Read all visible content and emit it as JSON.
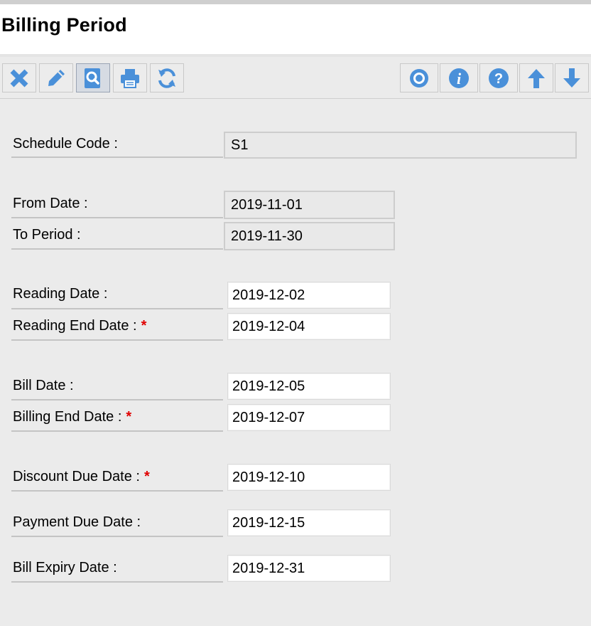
{
  "page": {
    "title": "Billing Period"
  },
  "toolbar": {
    "left_buttons": [
      {
        "name": "delete",
        "icon": "x-icon"
      },
      {
        "name": "edit",
        "icon": "pencil-icon"
      },
      {
        "name": "search",
        "icon": "magnifier-icon"
      },
      {
        "name": "print",
        "icon": "printer-icon"
      },
      {
        "name": "refresh",
        "icon": "refresh-icon"
      }
    ],
    "right_buttons": [
      {
        "name": "settings",
        "icon": "gear-icon"
      },
      {
        "name": "info",
        "icon": "info-icon"
      },
      {
        "name": "help",
        "icon": "help-icon"
      },
      {
        "name": "move-up",
        "icon": "arrow-up-icon"
      },
      {
        "name": "move-down",
        "icon": "arrow-down-icon"
      }
    ],
    "icon_color": "#4a90d9"
  },
  "form": {
    "schedule_code": {
      "label": "Schedule Code :",
      "value": "S1"
    },
    "from_date": {
      "label": "From Date :",
      "value": "2019-11-01"
    },
    "to_period": {
      "label": "To Period :",
      "value": "2019-11-30"
    },
    "reading_date": {
      "label": "Reading Date :",
      "value": "2019-12-02"
    },
    "reading_end_date": {
      "label": "Reading End Date :",
      "required": "*",
      "value": "2019-12-04"
    },
    "bill_date": {
      "label": "Bill Date :",
      "value": "2019-12-05"
    },
    "billing_end_date": {
      "label": "Billing End Date :",
      "required": "*",
      "value": "2019-12-07"
    },
    "discount_due_date": {
      "label": "Discount Due Date :",
      "required": "*",
      "value": "2019-12-10"
    },
    "payment_due_date": {
      "label": "Payment Due Date :",
      "value": "2019-12-15"
    },
    "bill_expiry_date": {
      "label": "Bill Expiry Date :",
      "value": "2019-12-31"
    }
  },
  "colors": {
    "required_marker": "#e00000",
    "readonly_field_bg": "#e9e9e9",
    "editable_field_bg": "#ffffff"
  }
}
